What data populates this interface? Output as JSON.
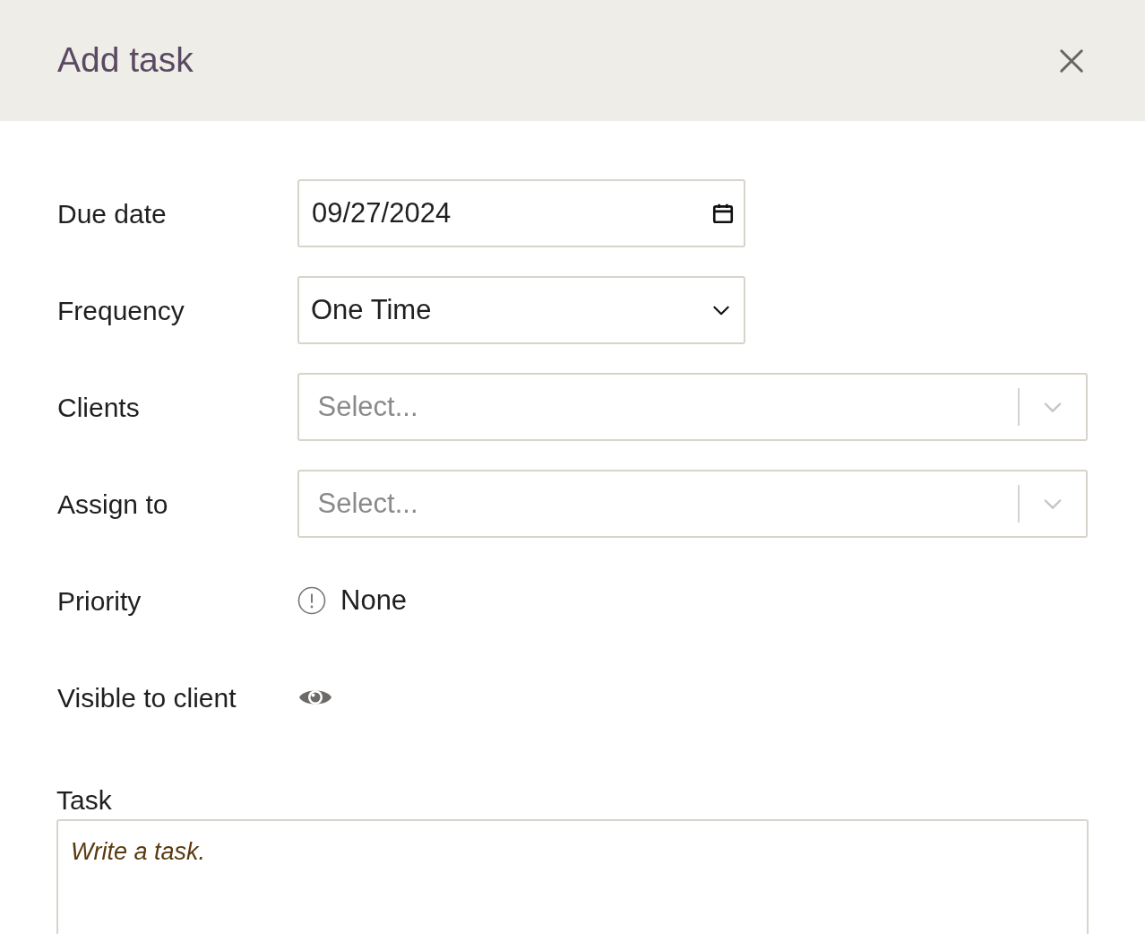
{
  "dialog": {
    "title": "Add task"
  },
  "fields": [
    {
      "kind": "date",
      "label": "Due date",
      "value": "09/27/2024"
    },
    {
      "kind": "select",
      "label": "Frequency",
      "value": "One Time"
    },
    {
      "kind": "multiselect",
      "label": "Clients",
      "placeholder": "Select..."
    },
    {
      "kind": "multiselect",
      "label": "Assign to",
      "placeholder": "Select..."
    },
    {
      "kind": "priority",
      "label": "Priority",
      "value": "None"
    },
    {
      "kind": "visibility",
      "label": "Visible to client"
    }
  ],
  "task": {
    "label": "Task",
    "placeholder": "Write a task."
  }
}
